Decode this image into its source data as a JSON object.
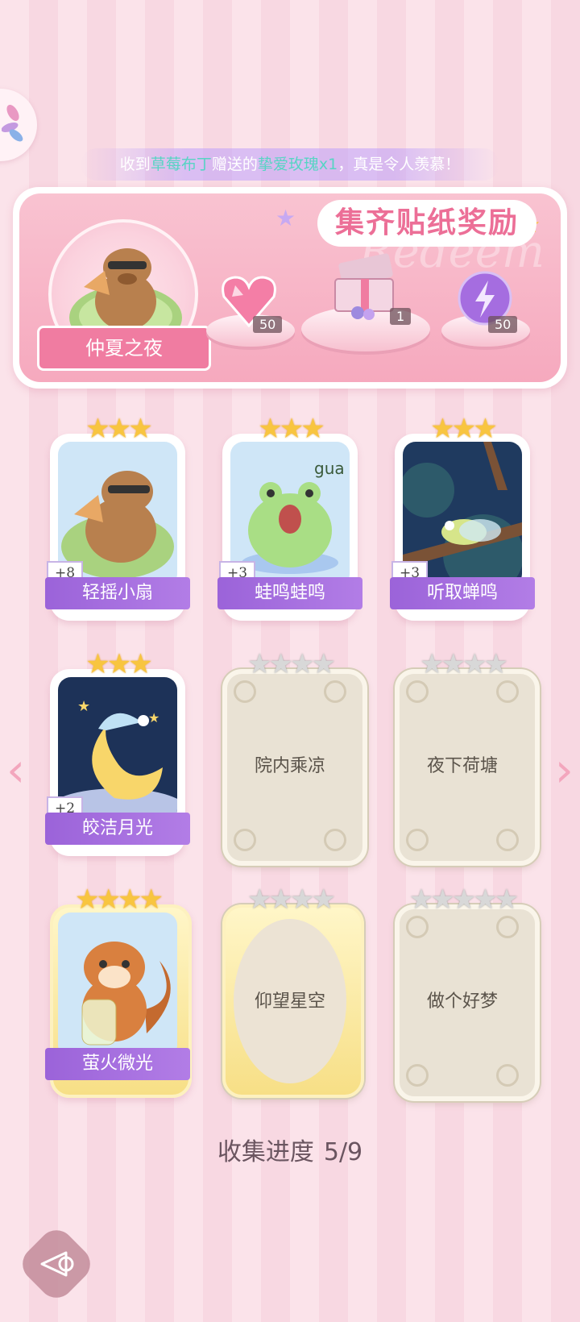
{
  "notice": {
    "prefix": "收到",
    "sender": "草莓布丁",
    "mid": "赠送的",
    "gift": "挚爱玫瑰x1",
    "suffix": "，真是令人羡慕！"
  },
  "panel": {
    "title": "集齐贴纸奖励",
    "watermark": "Redeem",
    "set_name": "仲夏之夜",
    "rewards": [
      {
        "icon": "pink-heart-gem-icon",
        "count": "50"
      },
      {
        "icon": "gift-box-icon",
        "count": "1"
      },
      {
        "icon": "purple-lightning-orb-icon",
        "count": "50"
      }
    ]
  },
  "cards": [
    {
      "name": "轻摇小扇",
      "bonus": "+8",
      "stars": 3,
      "unlocked": true,
      "art": "capybara-fan-icon"
    },
    {
      "name": "蛙鸣蛙鸣",
      "bonus": "+3",
      "stars": 3,
      "unlocked": true,
      "art": "frog-icon",
      "art_text": "gua"
    },
    {
      "name": "听取蝉鸣",
      "bonus": "+3",
      "stars": 3,
      "unlocked": true,
      "art": "cicada-icon"
    },
    {
      "name": "皎洁月光",
      "bonus": "+2",
      "stars": 3,
      "unlocked": true,
      "art": "moon-icon"
    },
    {
      "name": "院内乘凉",
      "stars": 4,
      "unlocked": false
    },
    {
      "name": "夜下荷塘",
      "stars": 4,
      "unlocked": false
    },
    {
      "name": "萤火微光",
      "stars": 4,
      "unlocked": true,
      "art": "squirrel-jar-icon"
    },
    {
      "name": "仰望星空",
      "stars": 4,
      "unlocked": false,
      "gold": true
    },
    {
      "name": "做个好梦",
      "stars": 5,
      "unlocked": false
    }
  ],
  "progress": {
    "label": "收集进度",
    "value": "5/9",
    "fraction": 0.5556
  },
  "colors": {
    "accent": "#ec6f97",
    "purple": "#9b63d9",
    "star_gold": "#f8c540"
  }
}
